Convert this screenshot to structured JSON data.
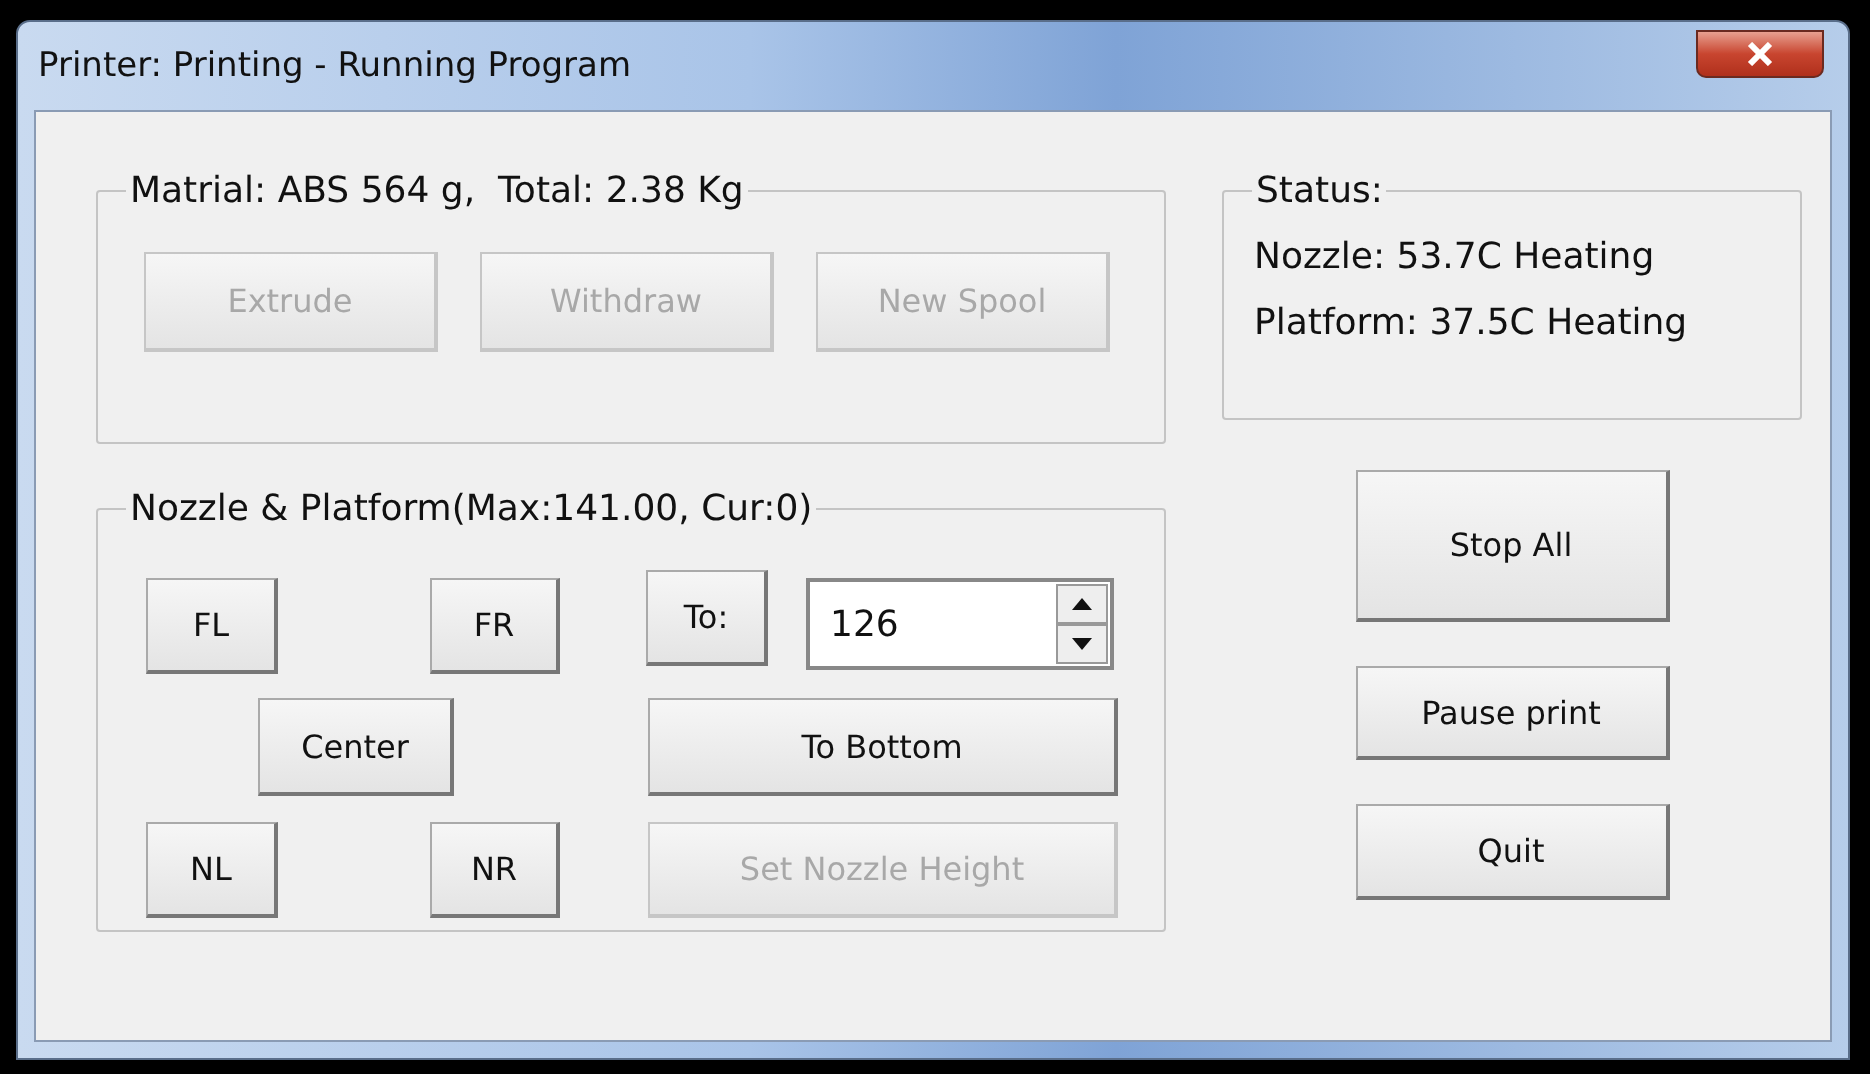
{
  "window": {
    "title": "Printer: Printing - Running Program"
  },
  "material": {
    "title": "Matrial: ABS 564 g,  Total: 2.38 Kg",
    "buttons": [
      {
        "label": "Extrude",
        "disabled": true
      },
      {
        "label": "Withdraw",
        "disabled": true
      },
      {
        "label": "New Spool",
        "disabled": true
      }
    ]
  },
  "position": {
    "title": "Nozzle & Platform(Max:141.00, Cur:0)",
    "moves": [
      {
        "label": "FL",
        "disabled": false
      },
      {
        "label": "FR",
        "disabled": false
      },
      {
        "label": "Center",
        "disabled": false
      },
      {
        "label": "NL",
        "disabled": false
      },
      {
        "label": "NR",
        "disabled": false
      }
    ],
    "to_button": {
      "label": "To:",
      "disabled": false
    },
    "height_field": {
      "value": "126"
    },
    "actions": [
      {
        "label": "To Bottom",
        "disabled": false
      },
      {
        "label": "Set Nozzle Height",
        "disabled": true
      }
    ]
  },
  "status": {
    "title": "Status:",
    "lines": [
      "Nozzle: 53.7C Heating",
      "Platform: 37.5C Heating"
    ]
  },
  "controls": [
    {
      "label": "Stop All",
      "disabled": false
    },
    {
      "label": "Pause print",
      "disabled": false
    },
    {
      "label": "Quit",
      "disabled": false
    }
  ]
}
